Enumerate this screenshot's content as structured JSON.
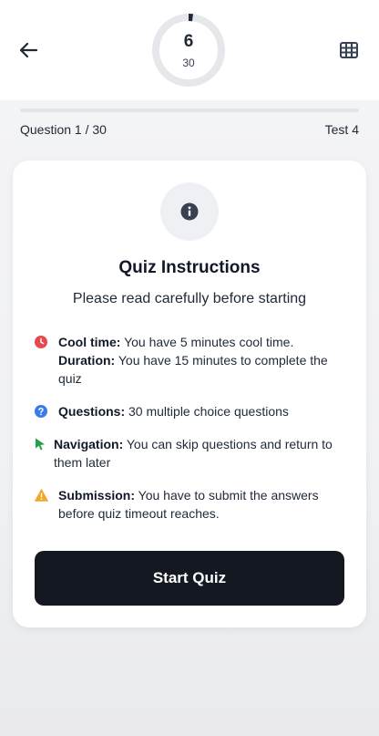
{
  "header": {
    "timer": {
      "value": "6",
      "total": "30",
      "progress": 0.02
    },
    "back_icon": "arrow-left-icon",
    "grid_icon": "grid-icon"
  },
  "progress": {
    "question_counter": "Question 1 / 30",
    "test_name": "Test 4",
    "fraction": 0.0
  },
  "card": {
    "icon": "info-icon",
    "title": "Quiz Instructions",
    "subtitle": "Please read carefully before starting",
    "items": [
      {
        "icon": "clock-icon",
        "color": "#e5484d",
        "lines": [
          {
            "label": "Cool time:",
            "text": " You have 5 minutes cool time."
          },
          {
            "label": "Duration:",
            "text": " You have 15 minutes to complete the quiz"
          }
        ]
      },
      {
        "icon": "question-icon",
        "color": "#3b7be8",
        "lines": [
          {
            "label": "Questions:",
            "text": " 30 multiple choice questions"
          }
        ]
      },
      {
        "icon": "cursor-icon",
        "color": "#22a34a",
        "lines": [
          {
            "label": "Navigation:",
            "text": " You can skip questions and return to them later"
          }
        ]
      },
      {
        "icon": "warning-icon",
        "color": "#f0a82a",
        "lines": [
          {
            "label": "Submission:",
            "text": " You have to submit the answers before quiz timeout reaches."
          }
        ]
      }
    ],
    "start_button": "Start Quiz"
  }
}
